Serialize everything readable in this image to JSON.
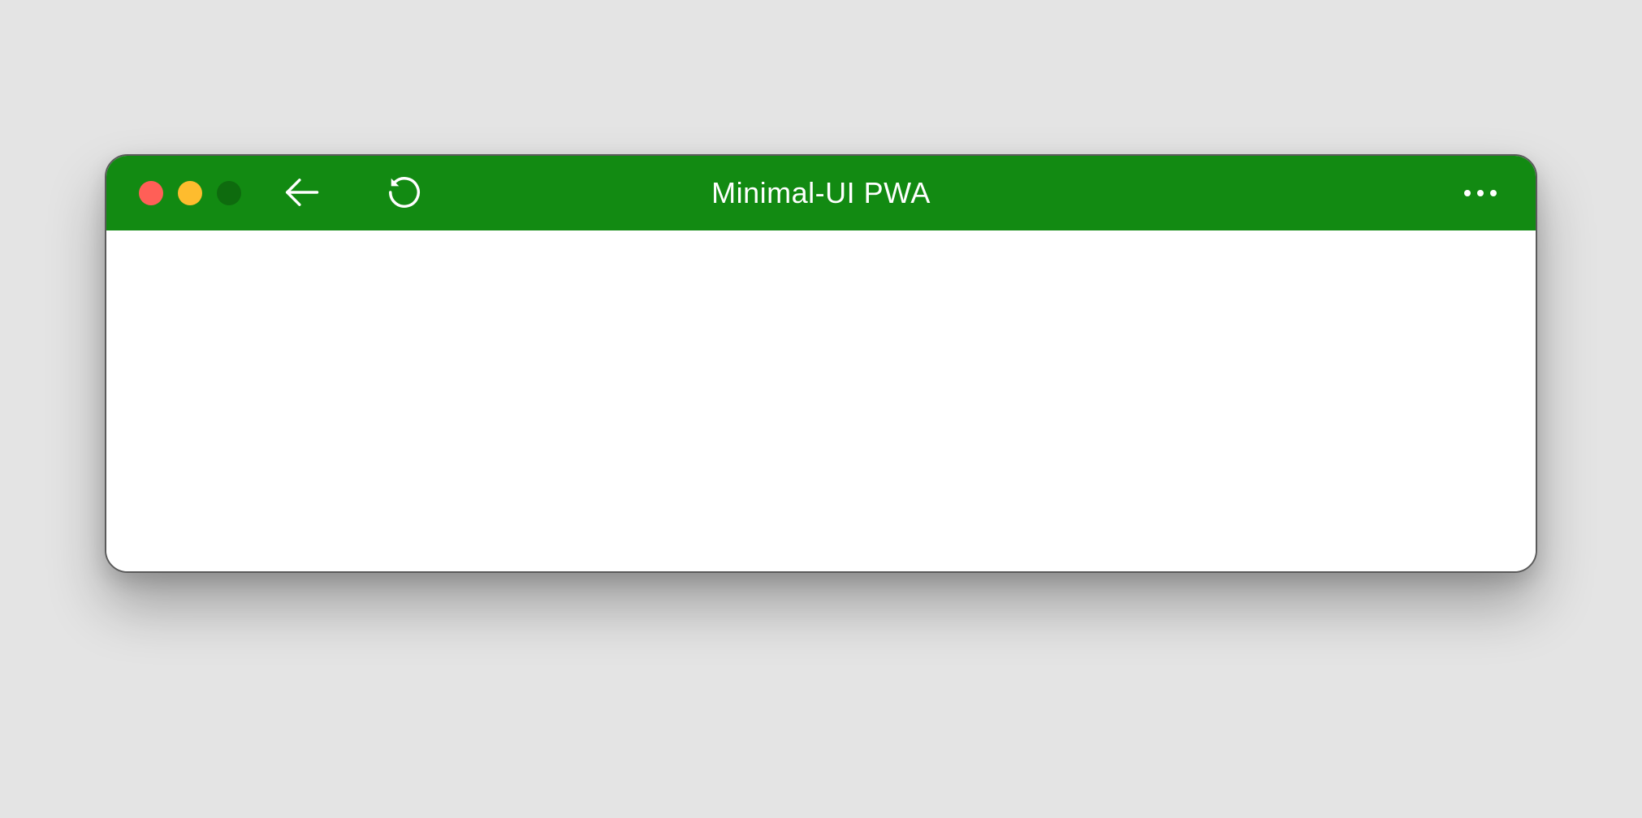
{
  "window": {
    "title": "Minimal-UI PWA"
  },
  "colors": {
    "titlebar_bg": "#128a12",
    "close": "#ff5f57",
    "minimize": "#febc2e",
    "maximize": "#0e6b0e"
  },
  "icons": {
    "back": "arrow-left-icon",
    "reload": "reload-icon",
    "menu": "more-horizontal-icon"
  }
}
